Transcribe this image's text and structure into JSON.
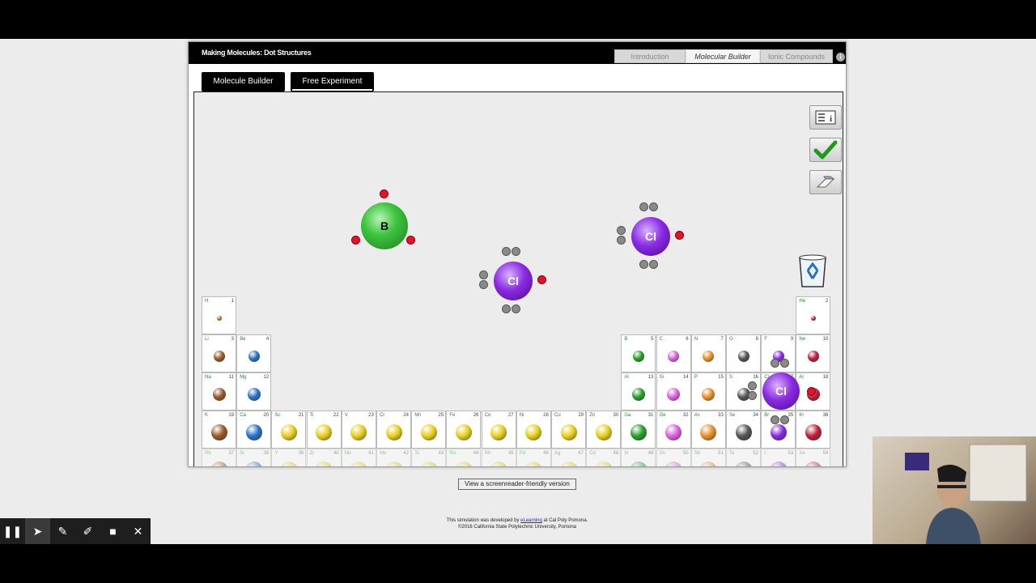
{
  "app": {
    "title": "Making Molecules: Dot Structures"
  },
  "top_tabs": [
    "Introduction",
    "Molecular Builder",
    "Ionic Compounds"
  ],
  "mode_tabs": {
    "molecule_builder": "Molecule Builder",
    "free_experiment": "Free Experiment"
  },
  "molecules": {
    "boron": "B",
    "chlorine_1": "Cl",
    "chlorine_2": "Cl",
    "dragged": "Cl"
  },
  "periodic_table": [
    {
      "sym": "H",
      "num": "1"
    },
    {
      "sym": "He",
      "num": "2"
    },
    {
      "sym": "Li",
      "num": "3"
    },
    {
      "sym": "Be",
      "num": "4"
    },
    {
      "sym": "B",
      "num": "5"
    },
    {
      "sym": "C",
      "num": "6"
    },
    {
      "sym": "N",
      "num": "7"
    },
    {
      "sym": "O",
      "num": "8"
    },
    {
      "sym": "F",
      "num": "9"
    },
    {
      "sym": "Ne",
      "num": "10"
    },
    {
      "sym": "Na",
      "num": "11"
    },
    {
      "sym": "Mg",
      "num": "12"
    },
    {
      "sym": "Al",
      "num": "13"
    },
    {
      "sym": "Si",
      "num": "14"
    },
    {
      "sym": "P",
      "num": "15"
    },
    {
      "sym": "S",
      "num": "16"
    },
    {
      "sym": "Cl",
      "num": "17"
    },
    {
      "sym": "Ar",
      "num": "18"
    },
    {
      "sym": "K",
      "num": "19"
    },
    {
      "sym": "Ca",
      "num": "20"
    },
    {
      "sym": "Sc",
      "num": "21"
    },
    {
      "sym": "Ti",
      "num": "22"
    },
    {
      "sym": "V",
      "num": "23"
    },
    {
      "sym": "Cr",
      "num": "24"
    },
    {
      "sym": "Mn",
      "num": "25"
    },
    {
      "sym": "Fe",
      "num": "26"
    },
    {
      "sym": "Co",
      "num": "27"
    },
    {
      "sym": "Ni",
      "num": "28"
    },
    {
      "sym": "Cu",
      "num": "29"
    },
    {
      "sym": "Zn",
      "num": "30"
    },
    {
      "sym": "Ga",
      "num": "31"
    },
    {
      "sym": "Ge",
      "num": "32"
    },
    {
      "sym": "As",
      "num": "33"
    },
    {
      "sym": "Se",
      "num": "34"
    },
    {
      "sym": "Br",
      "num": "35"
    },
    {
      "sym": "Kr",
      "num": "36"
    },
    {
      "sym": "Rb",
      "num": "37"
    },
    {
      "sym": "Sr",
      "num": "38"
    },
    {
      "sym": "Y",
      "num": "39"
    },
    {
      "sym": "Zr",
      "num": "40"
    },
    {
      "sym": "Nb",
      "num": "41"
    },
    {
      "sym": "Mo",
      "num": "42"
    },
    {
      "sym": "Tc",
      "num": "43"
    },
    {
      "sym": "Ru",
      "num": "44"
    },
    {
      "sym": "Rh",
      "num": "45"
    },
    {
      "sym": "Pd",
      "num": "46"
    },
    {
      "sym": "Ag",
      "num": "47"
    },
    {
      "sym": "Cd",
      "num": "48"
    },
    {
      "sym": "In",
      "num": "49"
    },
    {
      "sym": "Sn",
      "num": "50"
    },
    {
      "sym": "Sb",
      "num": "51"
    },
    {
      "sym": "Te",
      "num": "52"
    },
    {
      "sym": "I",
      "num": "53"
    },
    {
      "sym": "Xe",
      "num": "54"
    }
  ],
  "footer": {
    "screenreader_label": "View a screenreader-friendly version",
    "credit_line_prefix": "This simulation was developed by ",
    "credit_link": "eLearning",
    "credit_line_suffix": " at Cal Poly Pomona.",
    "copyright": "©2016 California State Polytechnic University, Pomona"
  },
  "colors": {
    "electron": "#e0142a",
    "boron": "#3ec43e",
    "chlorine": "#8a2be2",
    "lone_pair": "#8a8a8a"
  }
}
